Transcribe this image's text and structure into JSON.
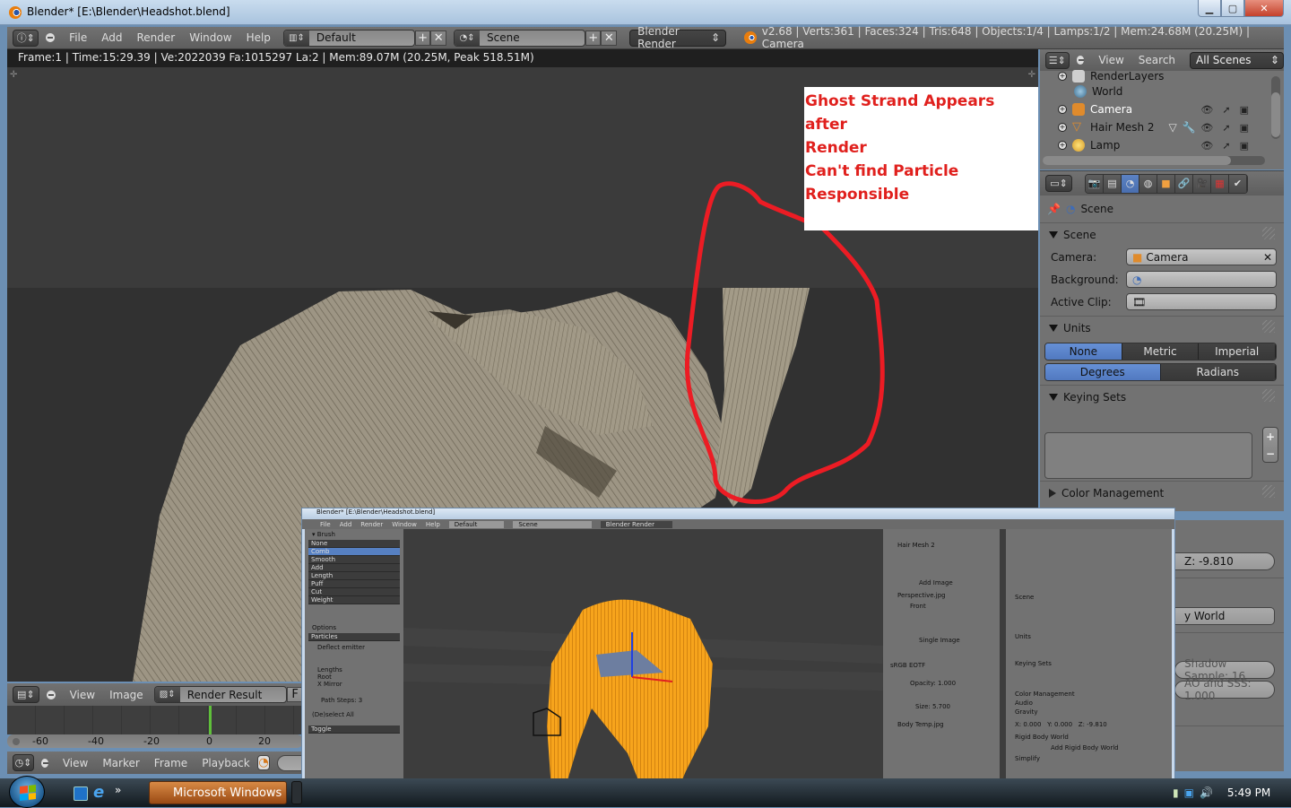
{
  "window": {
    "title": "Blender* [E:\\Blender\\Headshot.blend]",
    "controls": [
      "minimize",
      "maximize",
      "close"
    ]
  },
  "info_header": {
    "editor_type_icon": "info-icon",
    "menus": [
      "File",
      "Add",
      "Render",
      "Window",
      "Help"
    ],
    "screen_layout": "Default",
    "scene": "Scene",
    "render_engine": "Blender Render",
    "stats": "v2.68 | Verts:361 | Faces:324 | Tris:648 | Objects:1/4 | Lamps:1/2 | Mem:24.68M (20.25M) | Camera"
  },
  "image_editor": {
    "render_status": "Frame:1 | Time:15:29.39 | Ve:2022039 Fa:1015297 La:2 | Mem:89.07M (20.25M, Peak 518.51M)",
    "annotation_lines": [
      "Ghost Strand Appears after",
      "Render",
      "Can't find Particle",
      "Responsible"
    ],
    "annotation_color": "#e0201d",
    "header": {
      "menus": [
        "View",
        "Image"
      ],
      "image_name": "Render Result",
      "fake_user_label": "F"
    }
  },
  "timeline": {
    "ticks": [
      "-60",
      "-40",
      "-20",
      "0",
      "20"
    ],
    "current_frame_marker": "0",
    "header_menus": [
      "View",
      "Marker",
      "Frame",
      "Playback"
    ],
    "cursor_color": "#5fbf3a"
  },
  "outliner": {
    "header": {
      "menus": [
        "View",
        "Search"
      ],
      "display_mode": "All Scenes"
    },
    "items": [
      {
        "name": "RenderLayers",
        "icon": "render-layers-icon"
      },
      {
        "name": "World",
        "icon": "world-icon"
      },
      {
        "name": "Camera",
        "icon": "camera-object-icon"
      },
      {
        "name": "Hair Mesh 2",
        "icon": "mesh-object-icon"
      },
      {
        "name": "Lamp",
        "icon": "lamp-object-icon"
      }
    ]
  },
  "properties": {
    "context_tabs": [
      "render",
      "render-layers",
      "scene",
      "world",
      "object",
      "constraints",
      "data",
      "material",
      "particles"
    ],
    "active_tab": "scene",
    "breadcrumb": "Scene",
    "panels": {
      "scene": {
        "title": "Scene",
        "camera_label": "Camera:",
        "camera_value": "Camera",
        "background_label": "Background:",
        "active_clip_label": "Active Clip:"
      },
      "units": {
        "title": "Units",
        "systems": [
          "None",
          "Metric",
          "Imperial"
        ],
        "system_selected": "None",
        "rotation": [
          "Degrees",
          "Radians"
        ],
        "rotation_selected": "Degrees"
      },
      "keying_sets": {
        "title": "Keying Sets",
        "add": "+",
        "remove": "−"
      },
      "color_management": {
        "title": "Color Management"
      }
    },
    "partial_fields": {
      "gravity_z": "Z: -9.810",
      "rigid_body_world": "y World",
      "shadow_sample": "Shadow Sample: 16",
      "ao_sss": "AO and SSS: 1.000"
    }
  },
  "inset_screenshot": {
    "title": "Blender* [E:\\Blender\\Headshot.blend]",
    "menus": [
      "File",
      "Add",
      "Render",
      "Window",
      "Help"
    ],
    "layout": "Default",
    "scene": "Scene",
    "engine": "Blender Render",
    "brush_list": [
      "None",
      "Comb",
      "Smooth",
      "Add",
      "Length",
      "Puff",
      "Cut",
      "Weight"
    ],
    "brush_selected": "Comb",
    "options_title": "Options",
    "mode": "Particles",
    "deflect_emitter": "Deflect emitter",
    "keep": [
      "Lengths",
      "Root",
      "X Mirror"
    ],
    "path_steps": "Path Steps: 3",
    "select_all": "(De)select All",
    "action": "Toggle",
    "item_name": "Hair Mesh 2",
    "background_images": [
      "Perspective.jpg",
      "Body Temp.jpg"
    ],
    "bg_axis": "Front",
    "bg_source": "Single Image",
    "bg_color_space": "sRGB EOTF",
    "opacity": "Opacity: 1.000",
    "size": "Size: 5.700",
    "add_image": "Add Image",
    "right_panels": [
      "Scene",
      "Units",
      "Keying Sets",
      "Color Management",
      "Audio",
      "Gravity",
      "Rigid Body World",
      "Simplify"
    ],
    "gravity": [
      "X: 0.000",
      "Y: 0.000",
      "Z: -9.810"
    ],
    "rigid_body_button": "Add Rigid Body World",
    "hair_color": "#f7a41c"
  },
  "taskbar": {
    "active_window": "Microsoft Windows",
    "clock": "5:49 PM",
    "tray_icons": [
      "power-icon",
      "network-icon",
      "volume-icon"
    ]
  }
}
